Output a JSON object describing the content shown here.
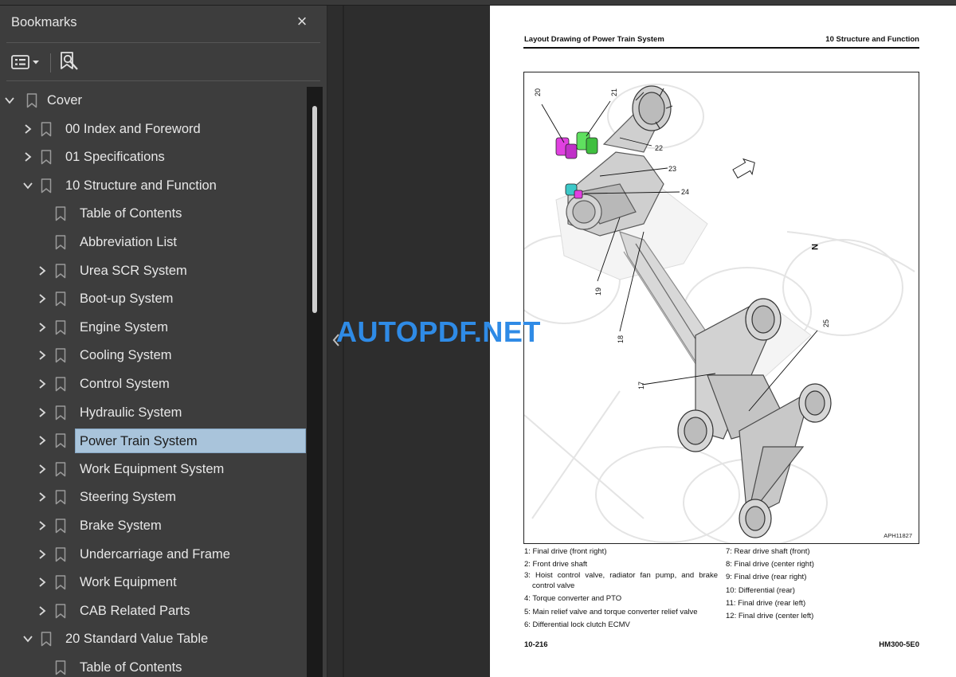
{
  "bookmarks": {
    "title": "Bookmarks",
    "close_symbol": "×",
    "tree": [
      {
        "label": "Cover",
        "expanded": true,
        "has_children": true,
        "level": 0
      },
      {
        "label": "00 Index and Foreword",
        "expanded": false,
        "has_children": true,
        "level": 1
      },
      {
        "label": "01 Specifications",
        "expanded": false,
        "has_children": true,
        "level": 1
      },
      {
        "label": "10 Structure and Function",
        "expanded": true,
        "has_children": true,
        "level": 1
      },
      {
        "label": "Table of Contents",
        "has_children": false,
        "level": 2
      },
      {
        "label": "Abbreviation List",
        "has_children": false,
        "level": 2
      },
      {
        "label": "Urea SCR System",
        "expanded": false,
        "has_children": true,
        "level": 2
      },
      {
        "label": "Boot-up System",
        "expanded": false,
        "has_children": true,
        "level": 2
      },
      {
        "label": "Engine System",
        "expanded": false,
        "has_children": true,
        "level": 2
      },
      {
        "label": "Cooling System",
        "expanded": false,
        "has_children": true,
        "level": 2
      },
      {
        "label": "Control System",
        "expanded": false,
        "has_children": true,
        "level": 2
      },
      {
        "label": "Hydraulic System",
        "expanded": false,
        "has_children": true,
        "level": 2
      },
      {
        "label": "Power Train System",
        "expanded": false,
        "has_children": true,
        "level": 2,
        "selected": true
      },
      {
        "label": "Work Equipment System",
        "expanded": false,
        "has_children": true,
        "level": 2
      },
      {
        "label": "Steering System",
        "expanded": false,
        "has_children": true,
        "level": 2
      },
      {
        "label": "Brake System",
        "expanded": false,
        "has_children": true,
        "level": 2
      },
      {
        "label": "Undercarriage and Frame",
        "expanded": false,
        "has_children": true,
        "level": 2
      },
      {
        "label": "Work Equipment",
        "expanded": false,
        "has_children": true,
        "level": 2
      },
      {
        "label": "CAB Related Parts",
        "expanded": false,
        "has_children": true,
        "level": 2
      },
      {
        "label": "20 Standard Value Table",
        "expanded": true,
        "has_children": true,
        "level": 1
      },
      {
        "label": "Table of Contents",
        "has_children": false,
        "level": 2
      }
    ]
  },
  "page": {
    "header_left": "Layout Drawing of Power Train System",
    "header_right": "10 Structure and Function",
    "figure_code": "APH11827",
    "callouts": [
      "20",
      "21",
      "22",
      "23",
      "24",
      "19",
      "18",
      "17",
      "25"
    ],
    "north_marker": "N",
    "legend_left": [
      {
        "text": "1: Final drive (front right)"
      },
      {
        "text": "2: Front drive shaft"
      },
      {
        "text": "3: Hoist control valve, radiator fan pump, and brake control valve",
        "wrap": true
      },
      {
        "text": "4: Torque converter and PTO"
      },
      {
        "text": "5: Main relief valve and torque converter relief valve"
      },
      {
        "text": "6: Differential lock clutch ECMV"
      }
    ],
    "legend_right": [
      {
        "text": "7: Rear drive shaft (front)"
      },
      {
        "text": "8: Final drive (center right)"
      },
      {
        "text": "9: Final drive (rear right)"
      },
      {
        "text": "10: Differential (rear)"
      },
      {
        "text": "11: Final drive (rear left)"
      },
      {
        "text": "12: Final drive (center left)"
      }
    ],
    "footer_left": "10-216",
    "footer_right": "HM300-5E0"
  },
  "watermark": "AUTOPDF.NET",
  "icons": {
    "panel_options": "list-options-icon",
    "find_bookmark": "find-bookmark-icon",
    "expand": "chevron-right-icon",
    "collapse": "chevron-down-icon",
    "bookmark": "bookmark-ribbon-icon"
  },
  "colors": {
    "panel_bg": "#3d3d3d",
    "selection_bg": "#a9c4db",
    "workspace_bg": "#2d2d2d",
    "watermark": "#2f8be6",
    "highlight_magenta": "#e040e0",
    "highlight_green": "#5fe05f",
    "highlight_cyan": "#3cc8c8"
  }
}
